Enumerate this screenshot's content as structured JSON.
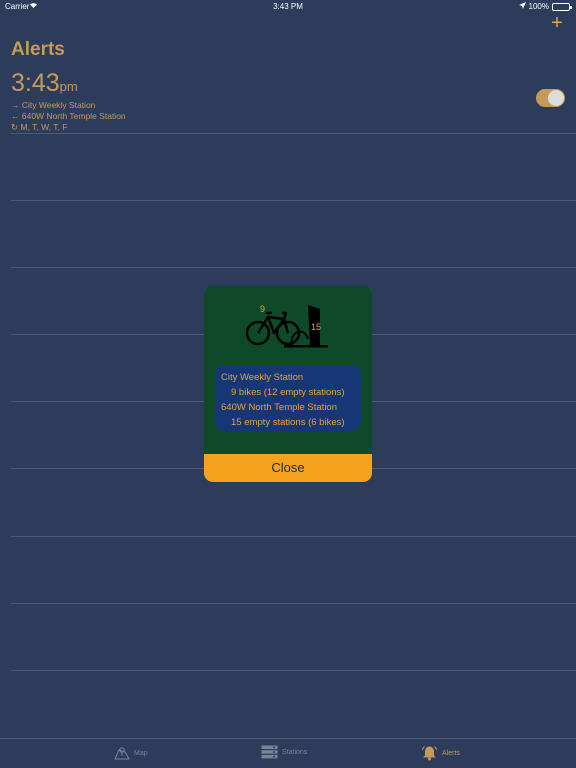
{
  "status_bar": {
    "carrier": "Carrier",
    "time": "3:43 PM",
    "battery": "100%"
  },
  "header": {
    "title": "Alerts",
    "add_icon": "plus-icon"
  },
  "alert": {
    "time": "3:43",
    "ampm": "pm",
    "from": "→ City Weekly Station",
    "to": "← 640W  North Temple Station",
    "days": "↻ M, T, W, T, F",
    "enabled": true
  },
  "popup": {
    "bike_count": "9",
    "dock_count": "15",
    "lines": [
      "City Weekly Station",
      "9 bikes (12 empty stations)",
      "640W  North Temple Station",
      "15 empty stations (6 bikes)"
    ],
    "close_label": "Close"
  },
  "tab_bar": {
    "tabs": [
      {
        "label": "Map",
        "icon": "map-icon"
      },
      {
        "label": "Stations",
        "icon": "stations-icon"
      },
      {
        "label": "Alerts",
        "icon": "bell-icon"
      }
    ],
    "active": "Alerts"
  },
  "colors": {
    "background": "#2c3c5a",
    "accent": "#c69a5a",
    "popup_green": "#0e4a2a",
    "popup_blue": "#163676",
    "close_orange": "#f5a21e"
  }
}
